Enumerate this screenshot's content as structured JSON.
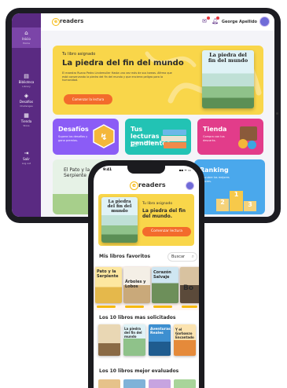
{
  "tablet": {
    "logo_text": "readers",
    "logo_mark": "e",
    "sidebar": [
      {
        "label": "Inicio",
        "sub": "Home",
        "icon": "home-icon",
        "glyph": "⌂"
      },
      {
        "label": "Biblioteca",
        "sub": "Library",
        "icon": "library-icon",
        "glyph": "▤"
      },
      {
        "label": "Desafíos",
        "sub": "Challenges",
        "icon": "challenges-icon",
        "glyph": "◈"
      },
      {
        "label": "Tienda",
        "sub": "Store",
        "icon": "store-icon",
        "glyph": "▦"
      },
      {
        "label": "Salir",
        "sub": "Log out",
        "icon": "logout-icon",
        "glyph": "⇥"
      }
    ],
    "user_name": "George Apellido",
    "hero": {
      "kicker": "Tu libro asignado",
      "title": "La piedra del fin del mundo",
      "description": "El maestro Ruano Pedro Lindemuller Hasta una vez más de sus tareas. Afirma que está conservando la piedra del fin del mundo y que encierra peligro para la humanidad.",
      "button": "Comenzar la lectura",
      "book_title": "La piedra del fin del mundo"
    },
    "cards": [
      {
        "title": "Desafíos",
        "subtitle": "Supera los desafíos y gana premios."
      },
      {
        "title": "Tus lecturas pendientes",
        "subtitle": "Avanza y finaliza tu libro."
      },
      {
        "title": "Tienda",
        "subtitle": "Compra con tus descarks."
      },
      {
        "title": "El Pato y la Serpiente",
        "subtitle": ""
      },
      {
        "title": "Ranking",
        "subtitle": "Descubre los mejores lectores."
      }
    ]
  },
  "phone": {
    "time": "9:41",
    "status": "▪▪ ᯤ ▭",
    "logo_text": "readers",
    "logo_mark": "e",
    "hero": {
      "book_title": "La piedra del fin del mundo",
      "kicker": "Tu libro asignado",
      "title": "La piedra del fin del mundo.",
      "button": "Comenzar lectura"
    },
    "favorites_title": "Mis libros favoritos",
    "search_label": "Buscar",
    "favorites": [
      {
        "title": "Pato y la Serpiente"
      },
      {
        "title": "Árboles y Lobos"
      },
      {
        "title": "Corazón Salvaje"
      },
      {
        "title": "Bo"
      }
    ],
    "most_requested_title": "Los 10 libros mas solicitados",
    "most_requested": [
      {
        "title": ""
      },
      {
        "title": "La piedra del fin del mundo"
      },
      {
        "title": "Aventuras Reales"
      },
      {
        "title": "Y el Garbanzo Encantado"
      }
    ],
    "best_rated_title": "Los 10 libros mejor evaluados"
  },
  "colors": {
    "purple": "#5a2a82",
    "yellow": "#f9d64a",
    "orange": "#f36b2c",
    "violet_card": "#8b5cf6",
    "teal_card": "#22c3b4",
    "pink_card": "#e23c8a",
    "blue_card": "#4aa8ec"
  }
}
